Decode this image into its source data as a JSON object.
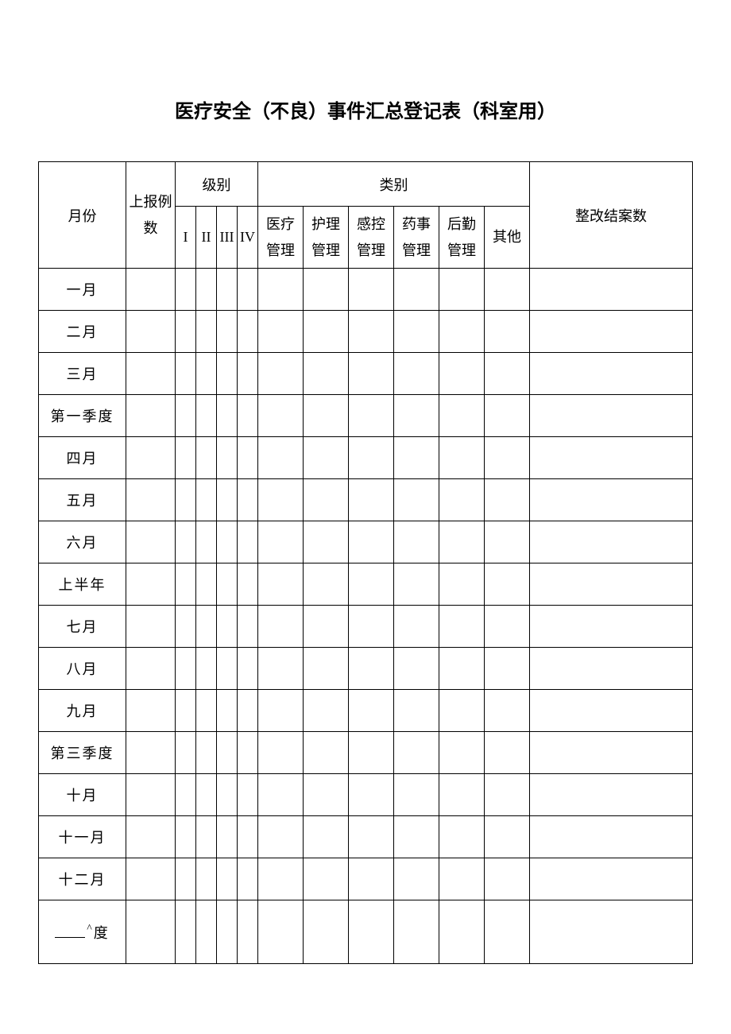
{
  "title": "医疗安全（不良）事件汇总登记表（科室用）",
  "headers": {
    "month": "月份",
    "report_count": "上报例数",
    "level_group": "级别",
    "category_group": "类别",
    "levels": [
      "I",
      "II",
      "III",
      "IV"
    ],
    "categories": [
      "医疗管理",
      "护理管理",
      "感控管理",
      "药事管理",
      "后勤管理",
      "其他"
    ],
    "close_count": "整改结案数"
  },
  "rows": [
    "一月",
    "二月",
    "三月",
    "第一季度",
    "四月",
    "五月",
    "六月",
    "上半年",
    "七月",
    "八月",
    "九月",
    "第三季度",
    "十月",
    "十一月",
    "十二月"
  ],
  "last_row_suffix": "度"
}
